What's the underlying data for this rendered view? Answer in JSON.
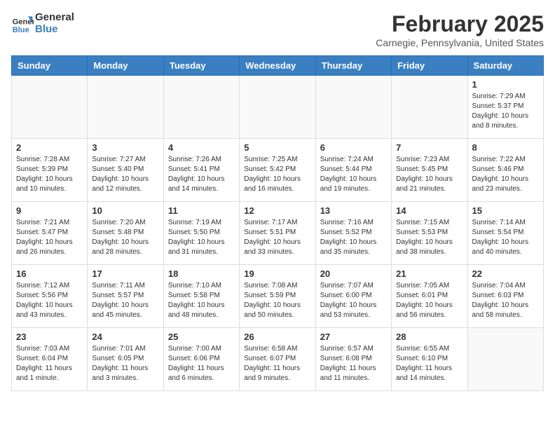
{
  "header": {
    "logo_line1": "General",
    "logo_line2": "Blue",
    "month": "February 2025",
    "location": "Carnegie, Pennsylvania, United States"
  },
  "weekdays": [
    "Sunday",
    "Monday",
    "Tuesday",
    "Wednesday",
    "Thursday",
    "Friday",
    "Saturday"
  ],
  "weeks": [
    [
      {
        "day": "",
        "info": ""
      },
      {
        "day": "",
        "info": ""
      },
      {
        "day": "",
        "info": ""
      },
      {
        "day": "",
        "info": ""
      },
      {
        "day": "",
        "info": ""
      },
      {
        "day": "",
        "info": ""
      },
      {
        "day": "1",
        "info": "Sunrise: 7:29 AM\nSunset: 5:37 PM\nDaylight: 10 hours\nand 8 minutes."
      }
    ],
    [
      {
        "day": "2",
        "info": "Sunrise: 7:28 AM\nSunset: 5:39 PM\nDaylight: 10 hours\nand 10 minutes."
      },
      {
        "day": "3",
        "info": "Sunrise: 7:27 AM\nSunset: 5:40 PM\nDaylight: 10 hours\nand 12 minutes."
      },
      {
        "day": "4",
        "info": "Sunrise: 7:26 AM\nSunset: 5:41 PM\nDaylight: 10 hours\nand 14 minutes."
      },
      {
        "day": "5",
        "info": "Sunrise: 7:25 AM\nSunset: 5:42 PM\nDaylight: 10 hours\nand 16 minutes."
      },
      {
        "day": "6",
        "info": "Sunrise: 7:24 AM\nSunset: 5:44 PM\nDaylight: 10 hours\nand 19 minutes."
      },
      {
        "day": "7",
        "info": "Sunrise: 7:23 AM\nSunset: 5:45 PM\nDaylight: 10 hours\nand 21 minutes."
      },
      {
        "day": "8",
        "info": "Sunrise: 7:22 AM\nSunset: 5:46 PM\nDaylight: 10 hours\nand 23 minutes."
      }
    ],
    [
      {
        "day": "9",
        "info": "Sunrise: 7:21 AM\nSunset: 5:47 PM\nDaylight: 10 hours\nand 26 minutes."
      },
      {
        "day": "10",
        "info": "Sunrise: 7:20 AM\nSunset: 5:48 PM\nDaylight: 10 hours\nand 28 minutes."
      },
      {
        "day": "11",
        "info": "Sunrise: 7:19 AM\nSunset: 5:50 PM\nDaylight: 10 hours\nand 31 minutes."
      },
      {
        "day": "12",
        "info": "Sunrise: 7:17 AM\nSunset: 5:51 PM\nDaylight: 10 hours\nand 33 minutes."
      },
      {
        "day": "13",
        "info": "Sunrise: 7:16 AM\nSunset: 5:52 PM\nDaylight: 10 hours\nand 35 minutes."
      },
      {
        "day": "14",
        "info": "Sunrise: 7:15 AM\nSunset: 5:53 PM\nDaylight: 10 hours\nand 38 minutes."
      },
      {
        "day": "15",
        "info": "Sunrise: 7:14 AM\nSunset: 5:54 PM\nDaylight: 10 hours\nand 40 minutes."
      }
    ],
    [
      {
        "day": "16",
        "info": "Sunrise: 7:12 AM\nSunset: 5:56 PM\nDaylight: 10 hours\nand 43 minutes."
      },
      {
        "day": "17",
        "info": "Sunrise: 7:11 AM\nSunset: 5:57 PM\nDaylight: 10 hours\nand 45 minutes."
      },
      {
        "day": "18",
        "info": "Sunrise: 7:10 AM\nSunset: 5:58 PM\nDaylight: 10 hours\nand 48 minutes."
      },
      {
        "day": "19",
        "info": "Sunrise: 7:08 AM\nSunset: 5:59 PM\nDaylight: 10 hours\nand 50 minutes."
      },
      {
        "day": "20",
        "info": "Sunrise: 7:07 AM\nSunset: 6:00 PM\nDaylight: 10 hours\nand 53 minutes."
      },
      {
        "day": "21",
        "info": "Sunrise: 7:05 AM\nSunset: 6:01 PM\nDaylight: 10 hours\nand 56 minutes."
      },
      {
        "day": "22",
        "info": "Sunrise: 7:04 AM\nSunset: 6:03 PM\nDaylight: 10 hours\nand 58 minutes."
      }
    ],
    [
      {
        "day": "23",
        "info": "Sunrise: 7:03 AM\nSunset: 6:04 PM\nDaylight: 11 hours\nand 1 minute."
      },
      {
        "day": "24",
        "info": "Sunrise: 7:01 AM\nSunset: 6:05 PM\nDaylight: 11 hours\nand 3 minutes."
      },
      {
        "day": "25",
        "info": "Sunrise: 7:00 AM\nSunset: 6:06 PM\nDaylight: 11 hours\nand 6 minutes."
      },
      {
        "day": "26",
        "info": "Sunrise: 6:58 AM\nSunset: 6:07 PM\nDaylight: 11 hours\nand 9 minutes."
      },
      {
        "day": "27",
        "info": "Sunrise: 6:57 AM\nSunset: 6:08 PM\nDaylight: 11 hours\nand 11 minutes."
      },
      {
        "day": "28",
        "info": "Sunrise: 6:55 AM\nSunset: 6:10 PM\nDaylight: 11 hours\nand 14 minutes."
      },
      {
        "day": "",
        "info": ""
      }
    ]
  ]
}
